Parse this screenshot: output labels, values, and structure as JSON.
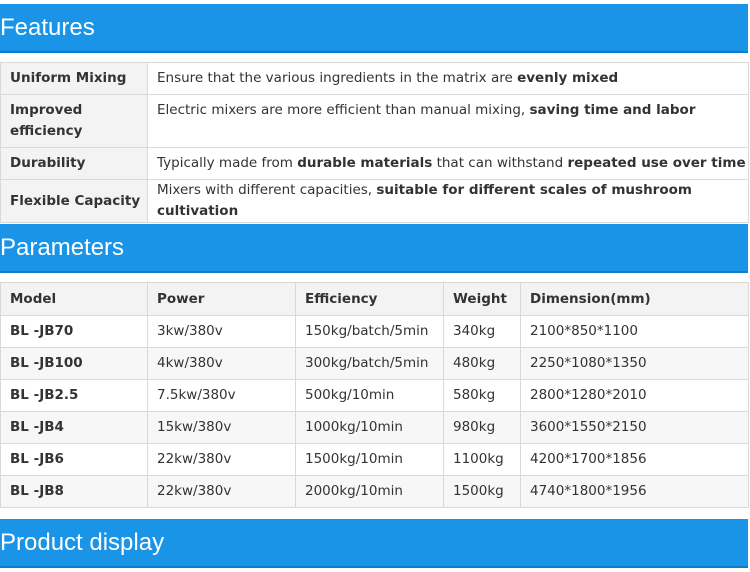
{
  "features": {
    "title": "Features",
    "rows": [
      {
        "name": "Uniform Mixing",
        "pre": "Ensure that the various ingredients in the matrix are ",
        "bold1": "evenly mixed",
        "mid": "",
        "bold2": ""
      },
      {
        "name": "Improved efficiency",
        "pre": "Electric mixers are more efficient than manual mixing, ",
        "bold1": "saving time and labor",
        "mid": "",
        "bold2": ""
      },
      {
        "name": "Durability",
        "pre": "Typically made from ",
        "bold1": "durable materials",
        "mid": " that can withstand ",
        "bold2": "repeated use over time"
      },
      {
        "name": "Flexible Capacity",
        "pre": "Mixers with different capacities, ",
        "bold1": "suitable for different scales of mushroom cultivation",
        "mid": "",
        "bold2": ""
      }
    ]
  },
  "parameters": {
    "title": "Parameters",
    "headers": [
      "Model",
      "Power",
      "Efficiency",
      "Weight",
      "Dimension(mm)"
    ],
    "rows": [
      [
        "BL -JB70",
        "3kw/380v",
        "150kg/batch/5min",
        "340kg",
        "2100*850*1100"
      ],
      [
        "BL -JB100",
        "4kw/380v",
        "300kg/batch/5min",
        "480kg",
        "2250*1080*1350"
      ],
      [
        "BL -JB2.5",
        "7.5kw/380v",
        "500kg/10min",
        "580kg",
        "2800*1280*2010"
      ],
      [
        "BL -JB4",
        "15kw/380v",
        "1000kg/10min",
        "980kg",
        "3600*1550*2150"
      ],
      [
        "BL -JB6",
        "22kw/380v",
        "1500kg/10min",
        "1100kg",
        "4200*1700*1856"
      ],
      [
        "BL -JB8",
        "22kw/380v",
        "2000kg/10min",
        "1500kg",
        "4740*1800*1956"
      ]
    ]
  },
  "product_display": {
    "title": "Product display"
  }
}
